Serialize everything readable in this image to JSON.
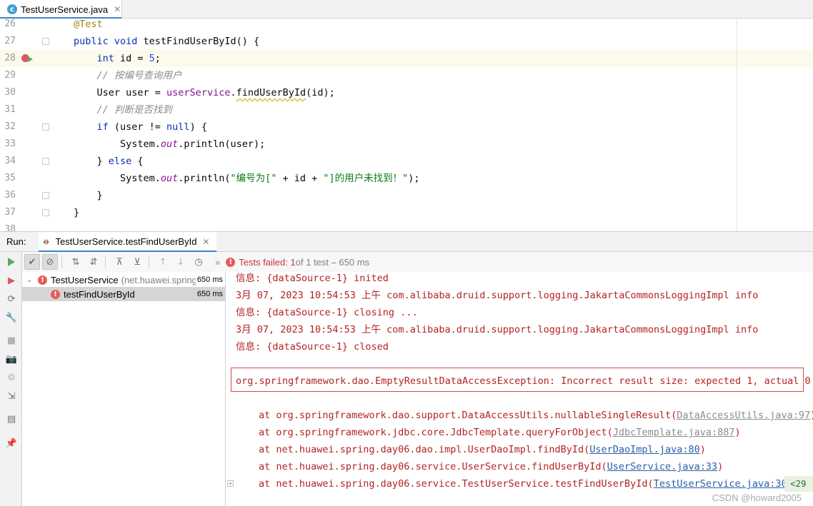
{
  "editor_tab": {
    "icon": "c",
    "file_name": "TestUserService.java",
    "close": "✕"
  },
  "code_lines": [
    {
      "num": "26",
      "indent": 0,
      "parts": [
        {
          "t": "@Test",
          "c": "ann"
        }
      ]
    },
    {
      "num": "27",
      "indent": 0,
      "parts": [
        {
          "t": "public ",
          "c": "kw"
        },
        {
          "t": "void ",
          "c": "kw"
        },
        {
          "t": "testFindUserById",
          "c": "fn"
        },
        {
          "t": "() {",
          "c": ""
        }
      ]
    },
    {
      "num": "28",
      "indent": 1,
      "current": true,
      "parts": [
        {
          "t": "int ",
          "c": "kw"
        },
        {
          "t": "id = ",
          "c": ""
        },
        {
          "t": "5",
          "c": "num"
        },
        {
          "t": ";",
          "c": ""
        }
      ]
    },
    {
      "num": "29",
      "indent": 1,
      "parts": [
        {
          "t": "// 按编号查询用户",
          "c": "cm"
        }
      ]
    },
    {
      "num": "30",
      "indent": 1,
      "parts": [
        {
          "t": "User user = ",
          "c": ""
        },
        {
          "t": "userService",
          "c": "field"
        },
        {
          "t": ".",
          "c": ""
        },
        {
          "t": "findUserById",
          "c": "warn"
        },
        {
          "t": "(id);",
          "c": ""
        }
      ]
    },
    {
      "num": "31",
      "indent": 1,
      "parts": [
        {
          "t": "// 判断是否找到",
          "c": "cm"
        }
      ]
    },
    {
      "num": "32",
      "indent": 1,
      "parts": [
        {
          "t": "if ",
          "c": "kw"
        },
        {
          "t": "(user != ",
          "c": ""
        },
        {
          "t": "null",
          "c": "kw"
        },
        {
          "t": ") {",
          "c": ""
        }
      ]
    },
    {
      "num": "33",
      "indent": 2,
      "parts": [
        {
          "t": "System.",
          "c": ""
        },
        {
          "t": "out",
          "c": "st-field"
        },
        {
          "t": ".println(user);",
          "c": ""
        }
      ]
    },
    {
      "num": "34",
      "indent": 1,
      "parts": [
        {
          "t": "} ",
          "c": ""
        },
        {
          "t": "else ",
          "c": "kw"
        },
        {
          "t": "{",
          "c": ""
        }
      ]
    },
    {
      "num": "35",
      "indent": 2,
      "parts": [
        {
          "t": "System.",
          "c": ""
        },
        {
          "t": "out",
          "c": "st-field"
        },
        {
          "t": ".println(",
          "c": ""
        },
        {
          "t": "\"编号为[\"",
          "c": "str"
        },
        {
          "t": " + id + ",
          "c": ""
        },
        {
          "t": "\"]的用户未找到！\"",
          "c": "str"
        },
        {
          "t": ");",
          "c": ""
        }
      ]
    },
    {
      "num": "36",
      "indent": 1,
      "parts": [
        {
          "t": "}",
          "c": ""
        }
      ]
    },
    {
      "num": "37",
      "indent": 0,
      "parts": [
        {
          "t": "}",
          "c": ""
        }
      ]
    },
    {
      "num": "38",
      "indent": 0,
      "parts": []
    }
  ],
  "run_panel": {
    "label": "Run:",
    "tab_label": "TestUserService.testFindUserById",
    "tab_close": "✕"
  },
  "test_toolbar": {
    "more": "»",
    "status_failed": "Tests failed: 1",
    "status_rest": " of 1 test – 650 ms"
  },
  "test_tree": [
    {
      "name": "TestUserService",
      "pkg": "(net.huawei.spring",
      "time": "650 ms",
      "arrow": "⌄"
    },
    {
      "name": "testFindUserById",
      "pkg": "",
      "time": "650 ms",
      "selected": true
    }
  ],
  "console": {
    "lines": [
      "信息: {dataSource-1} inited",
      "3月 07, 2023 10:54:53 上午 com.alibaba.druid.support.logging.JakartaCommonsLoggingImpl info",
      "信息: {dataSource-1} closing ...",
      "3月 07, 2023 10:54:53 上午 com.alibaba.druid.support.logging.JakartaCommonsLoggingImpl info",
      "信息: {dataSource-1} closed"
    ],
    "exception": "org.springframework.dao.EmptyResultDataAccessException: Incorrect result size: expected 1, actual 0",
    "trace": [
      {
        "prefix": "at org.springframework.dao.support.DataAccessUtils.nullableSingleResult(",
        "link": "DataAccessUtils.java:97",
        "suffix": ")",
        "grey": true
      },
      {
        "prefix": "at org.springframework.jdbc.core.JdbcTemplate.queryForObject(",
        "link": "JdbcTemplate.java:887",
        "suffix": ")",
        "grey": true
      },
      {
        "prefix": "at net.huawei.spring.day06.dao.impl.UserDaoImpl.findById(",
        "link": "UserDaoImpl.java:80",
        "suffix": ")",
        "grey": false
      },
      {
        "prefix": "at net.huawei.spring.day06.service.UserService.findUserById(",
        "link": "UserService.java:33",
        "suffix": ")",
        "grey": false
      },
      {
        "prefix": "at net.huawei.spring.day06.service.TestUserService.testFindUserById(",
        "link": "TestUserService.java:30",
        "suffix": ")",
        "grey": false
      }
    ],
    "more_badge": "<29",
    "watermark": "CSDN @howard2005"
  },
  "colors": {
    "keyword": "#0033b3",
    "annotation": "#9e880d",
    "string": "#067d17",
    "error_text": "#b32323",
    "link": "#2a5fa8",
    "accent": "#4083c9"
  }
}
